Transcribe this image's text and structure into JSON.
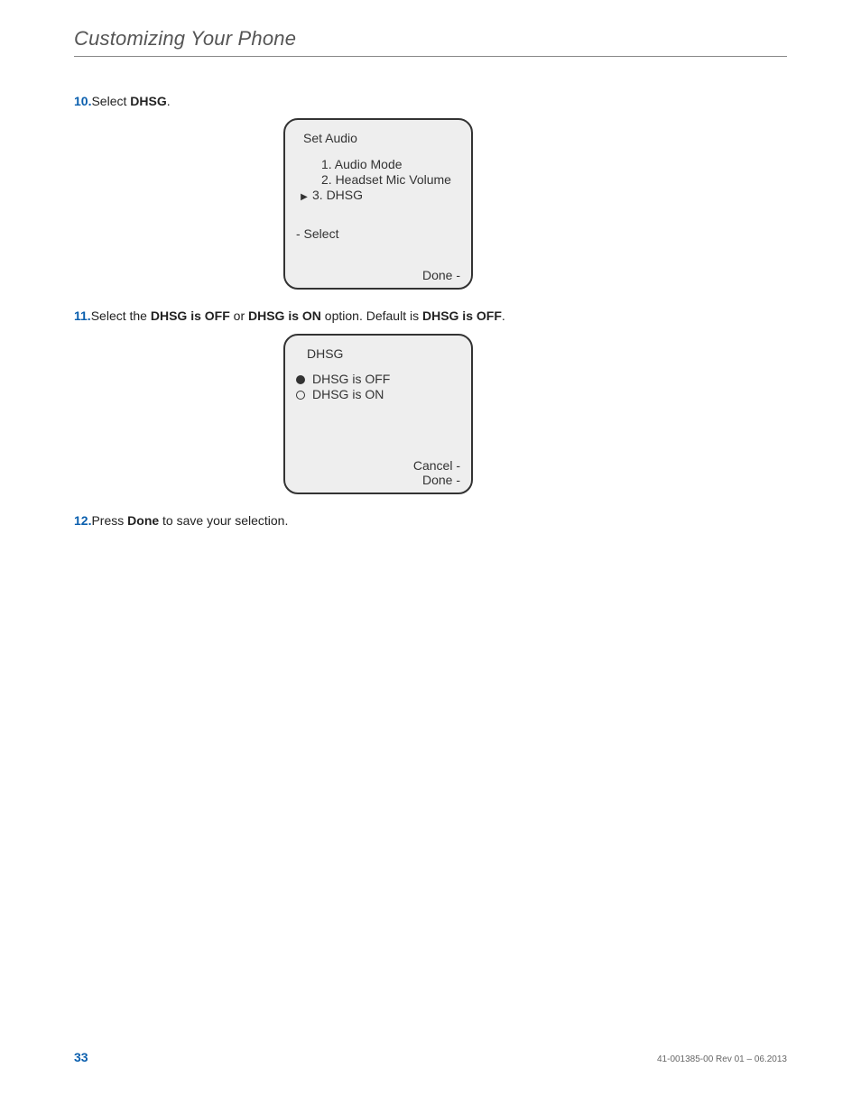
{
  "header": {
    "title": "Customizing Your Phone"
  },
  "steps": {
    "s10": {
      "num": "10.",
      "prefix": "Select ",
      "bold": "DHSG",
      "suffix": "."
    },
    "s11": {
      "num": "11.",
      "parts": {
        "t0": "Select the ",
        "b0": "DHSG is OFF",
        "t1": " or ",
        "b1": "DHSG is ON",
        "t2": " option. Default is ",
        "b2": "DHSG is OFF",
        "t3": "."
      }
    },
    "s12": {
      "num": "12.",
      "prefix": "Press ",
      "bold": "Done",
      "suffix": " to save your selection."
    }
  },
  "screenA": {
    "title": "Set Audio",
    "menu": [
      {
        "label": "1. Audio Mode",
        "selected": false
      },
      {
        "label": "2. Headset Mic Volume",
        "selected": false
      },
      {
        "label": "3. DHSG",
        "selected": true
      }
    ],
    "hint": "- Select",
    "actions": {
      "done": "Done -"
    }
  },
  "screenB": {
    "title": "DHSG",
    "options": [
      {
        "label": "DHSG is OFF",
        "selected": true
      },
      {
        "label": "DHSG is ON",
        "selected": false
      }
    ],
    "actions": {
      "cancel": "Cancel -",
      "done": "Done -"
    }
  },
  "footer": {
    "page": "33",
    "rev": "41-001385-00 Rev 01 – 06.2013"
  }
}
